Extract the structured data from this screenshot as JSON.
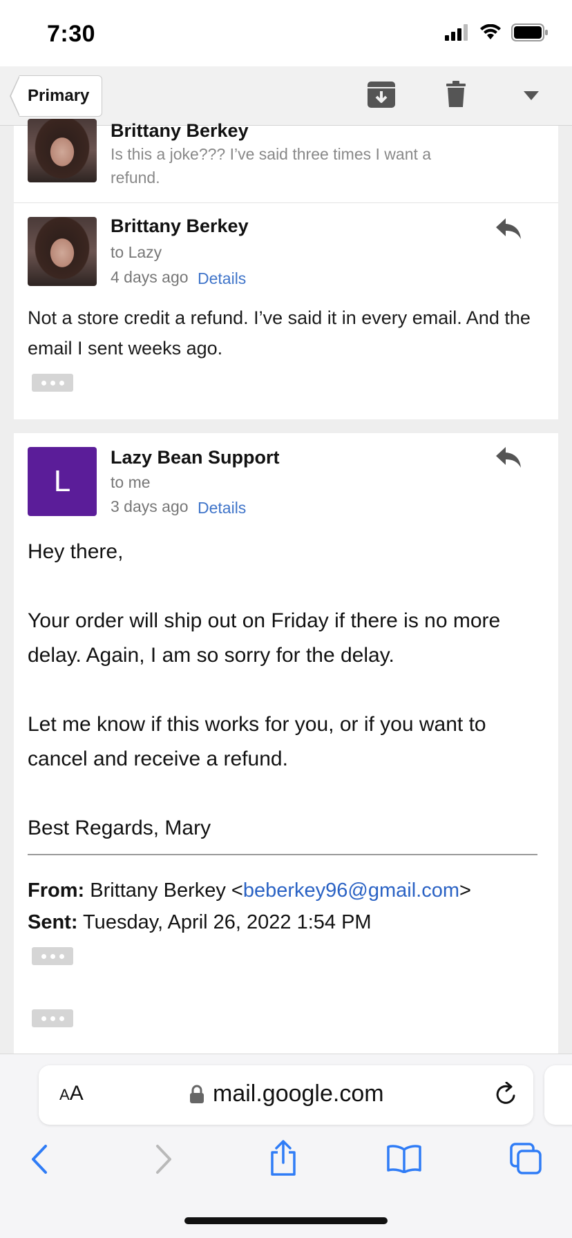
{
  "status_bar": {
    "time": "7:30"
  },
  "toolbar": {
    "back_label": "Primary",
    "icons": [
      "archive-icon",
      "trash-icon",
      "dropdown-caret-icon"
    ]
  },
  "thread": {
    "collapsed_message": {
      "sender": "Brittany Berkey",
      "snippet": "Is this a joke??? I’ve said three times I want a refund."
    },
    "message_one": {
      "sender": "Brittany Berkey",
      "recipient": "to Lazy",
      "time": "4 days ago",
      "details_label": "Details",
      "body": "Not a store credit a refund. I’ve said it in every email. And the email I sent weeks ago."
    },
    "message_two": {
      "avatar_letter": "L",
      "sender": "Lazy Bean Support",
      "recipient": "to me",
      "time": "3 days ago",
      "details_label": "Details",
      "greeting": "Hey there,",
      "paragraph_one": "Your order will ship out on Friday if there is no more delay. Again, I am so sorry for the delay.",
      "paragraph_two": "Let me know if this works for you, or if you want to cancel and receive a refund.",
      "signoff": "Best Regards, Mary",
      "quoted": {
        "from_label": "From:",
        "from_name": "Brittany Berkey <",
        "from_email": "beberkey96@gmail.com",
        "from_close": ">",
        "sent_label": "Sent:",
        "sent_value": "Tuesday, April 26, 2022 1:54 PM"
      }
    }
  },
  "browser": {
    "text_size_label": "AA",
    "url": "mail.google.com"
  }
}
